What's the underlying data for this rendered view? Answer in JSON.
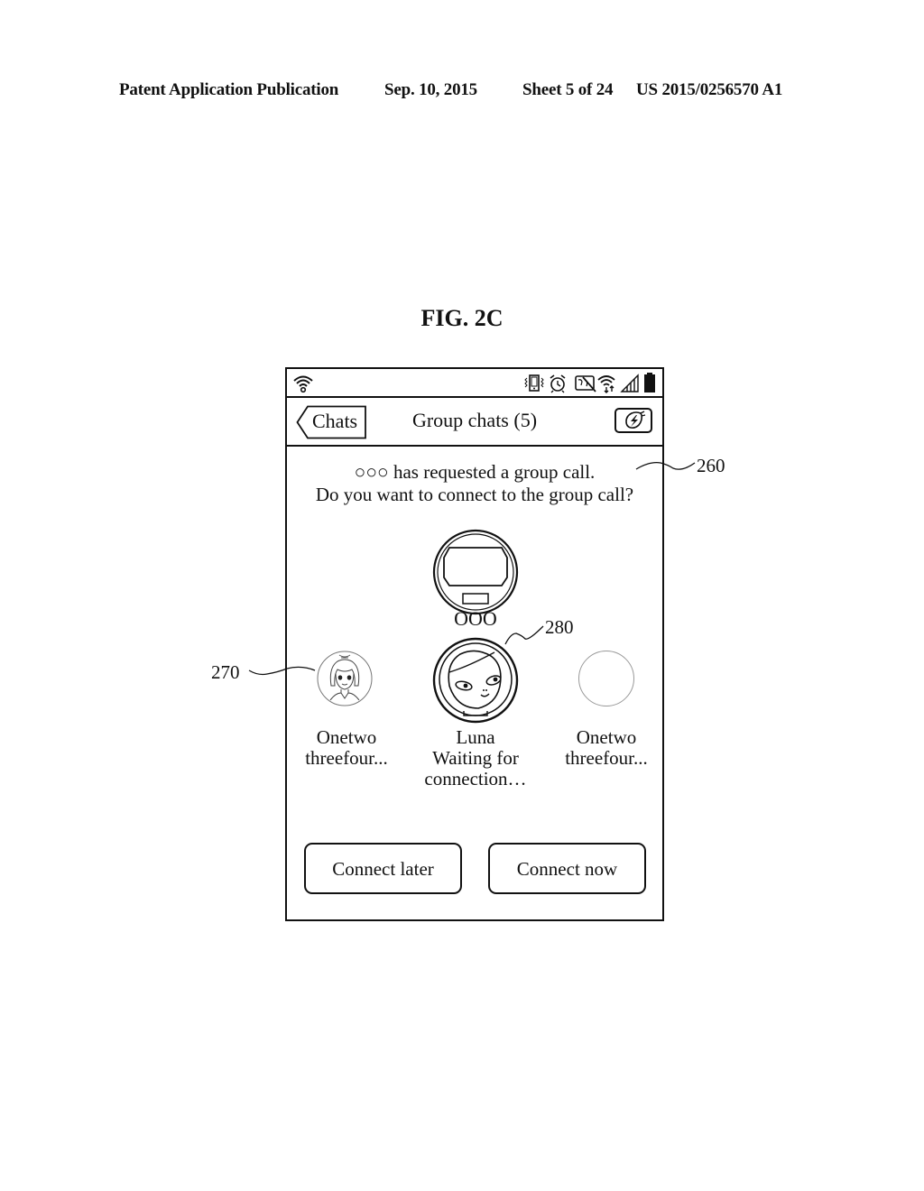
{
  "page_header": {
    "publication": "Patent Application Publication",
    "date": "Sep. 10, 2015",
    "sheet": "Sheet 5 of 24",
    "number": "US 2015/0256570 A1"
  },
  "figure_label": "FIG. 2C",
  "status_bar": {
    "icons": [
      "wifi-icon",
      "vibrate-icon",
      "alarm-icon",
      "screen-mirroring-off-icon",
      "wifi-download-icon",
      "signal-icon",
      "battery-icon"
    ]
  },
  "nav_bar": {
    "back_label": "Chats",
    "title": "Group chats (5)",
    "action_icon": "flash-icon"
  },
  "message": {
    "line1": "○○○ has requested a group call.",
    "line2": "Do you want to connect to the group call?"
  },
  "caller": {
    "name": "OOO"
  },
  "participants": [
    {
      "name_line1": "Onetwo",
      "name_line2": "threefour...",
      "status": ""
    },
    {
      "name_line1": "Luna",
      "name_line2": "Waiting for",
      "name_line3": "connection…"
    },
    {
      "name_line1": "Onetwo",
      "name_line2": "threefour...",
      "status": ""
    }
  ],
  "buttons": {
    "connect_later": "Connect later",
    "connect_now": "Connect now"
  },
  "reference_numerals": {
    "message": "260",
    "participant_avatar": "270",
    "waiting_avatar": "280"
  }
}
